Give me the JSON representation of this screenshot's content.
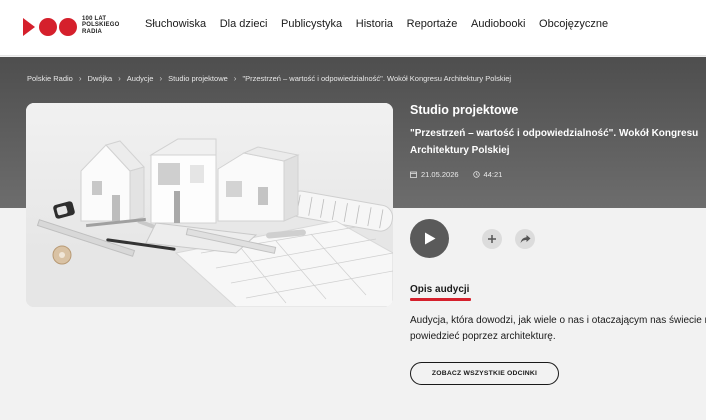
{
  "brand": {
    "logo_text_lines": [
      "100 LAT",
      "POLSKIEGO",
      "RADIA"
    ],
    "accent_color": "#d5202c"
  },
  "nav": {
    "items": [
      {
        "label": "Słuchowiska"
      },
      {
        "label": "Dla dzieci"
      },
      {
        "label": "Publicystyka"
      },
      {
        "label": "Historia"
      },
      {
        "label": "Reportaże"
      },
      {
        "label": "Audiobooki"
      },
      {
        "label": "Obcojęzyczne"
      }
    ]
  },
  "breadcrumb": {
    "items": [
      {
        "label": "Polskie Radio"
      },
      {
        "label": "Dwójka"
      },
      {
        "label": "Audycje"
      },
      {
        "label": "Studio projektowe"
      },
      {
        "label": "\"Przestrzeń – wartość i odpowiedzialność\". Wokół Kongresu Architektury Polskiej"
      }
    ],
    "separator": "›"
  },
  "episode": {
    "show_title": "Studio projektowe",
    "title": "\"Przestrzeń – wartość i odpowiedzialność\". Wokół Kongresu Architektury Polskiej",
    "date": "21.05.2026",
    "duration": "44:21",
    "image_icon": "architecture-model-photo"
  },
  "actions": {
    "play_icon": "play-icon",
    "add_icon": "plus-icon",
    "share_icon": "share-icon"
  },
  "tabs": {
    "description_label": "Opis audycji"
  },
  "description": {
    "text": "Audycja, która dowodzi, jak wiele o nas i otaczającym nas świecie może powiedzieć poprzez architekturę."
  },
  "buttons": {
    "all_episodes_label": "ZOBACZ WSZYSTKIE ODCINKI"
  }
}
